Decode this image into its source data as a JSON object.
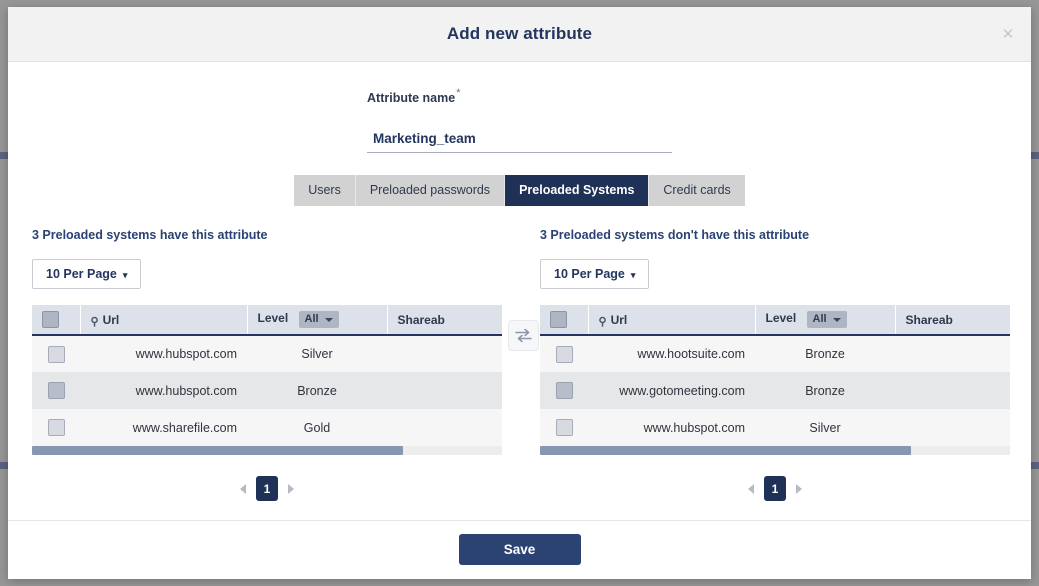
{
  "modal": {
    "title": "Add new attribute",
    "close_icon": "close-icon"
  },
  "form": {
    "attribute_name_label": "Attribute name",
    "required_marker": "*",
    "attribute_name_value": "Marketing_team",
    "attribute_name_placeholder": "Attribute name"
  },
  "tabs": [
    {
      "label": "Users",
      "active": false
    },
    {
      "label": "Preloaded passwords",
      "active": false
    },
    {
      "label": "Preloaded Systems",
      "active": true
    },
    {
      "label": "Credit cards",
      "active": false
    }
  ],
  "transfer": {
    "icon": "transfer-arrows-icon"
  },
  "left_panel": {
    "title": "3 Preloaded systems have this attribute",
    "per_page_label": "10 Per Page",
    "columns": {
      "checkbox": "",
      "url": "Url",
      "level": "Level",
      "level_filter": "All",
      "shareable": "Shareab",
      "extra": ""
    },
    "rows": [
      {
        "url": "www.hubspot.com",
        "level": "Silver"
      },
      {
        "url": "www.hubspot.com",
        "level": "Bronze"
      },
      {
        "url": "www.sharefile.com",
        "level": "Gold"
      }
    ],
    "pagination": {
      "current": "1"
    }
  },
  "right_panel": {
    "title": "3 Preloaded systems don't have this attribute",
    "per_page_label": "10 Per Page",
    "columns": {
      "checkbox": "",
      "url": "Url",
      "level": "Level",
      "level_filter": "All",
      "shareable": "Shareab",
      "extra": ""
    },
    "rows": [
      {
        "url": "www.hootsuite.com",
        "level": "Bronze"
      },
      {
        "url": "www.gotomeeting.com",
        "level": "Bronze"
      },
      {
        "url": "www.hubspot.com",
        "level": "Silver"
      }
    ],
    "pagination": {
      "current": "1"
    }
  },
  "footer": {
    "save_label": "Save"
  },
  "colors": {
    "brand_navy": "#1f3157",
    "accent_blue": "#2a4372",
    "header_grey": "#f2f2f2",
    "table_header": "#dde1e9",
    "scroll_thumb": "#8897b1"
  }
}
